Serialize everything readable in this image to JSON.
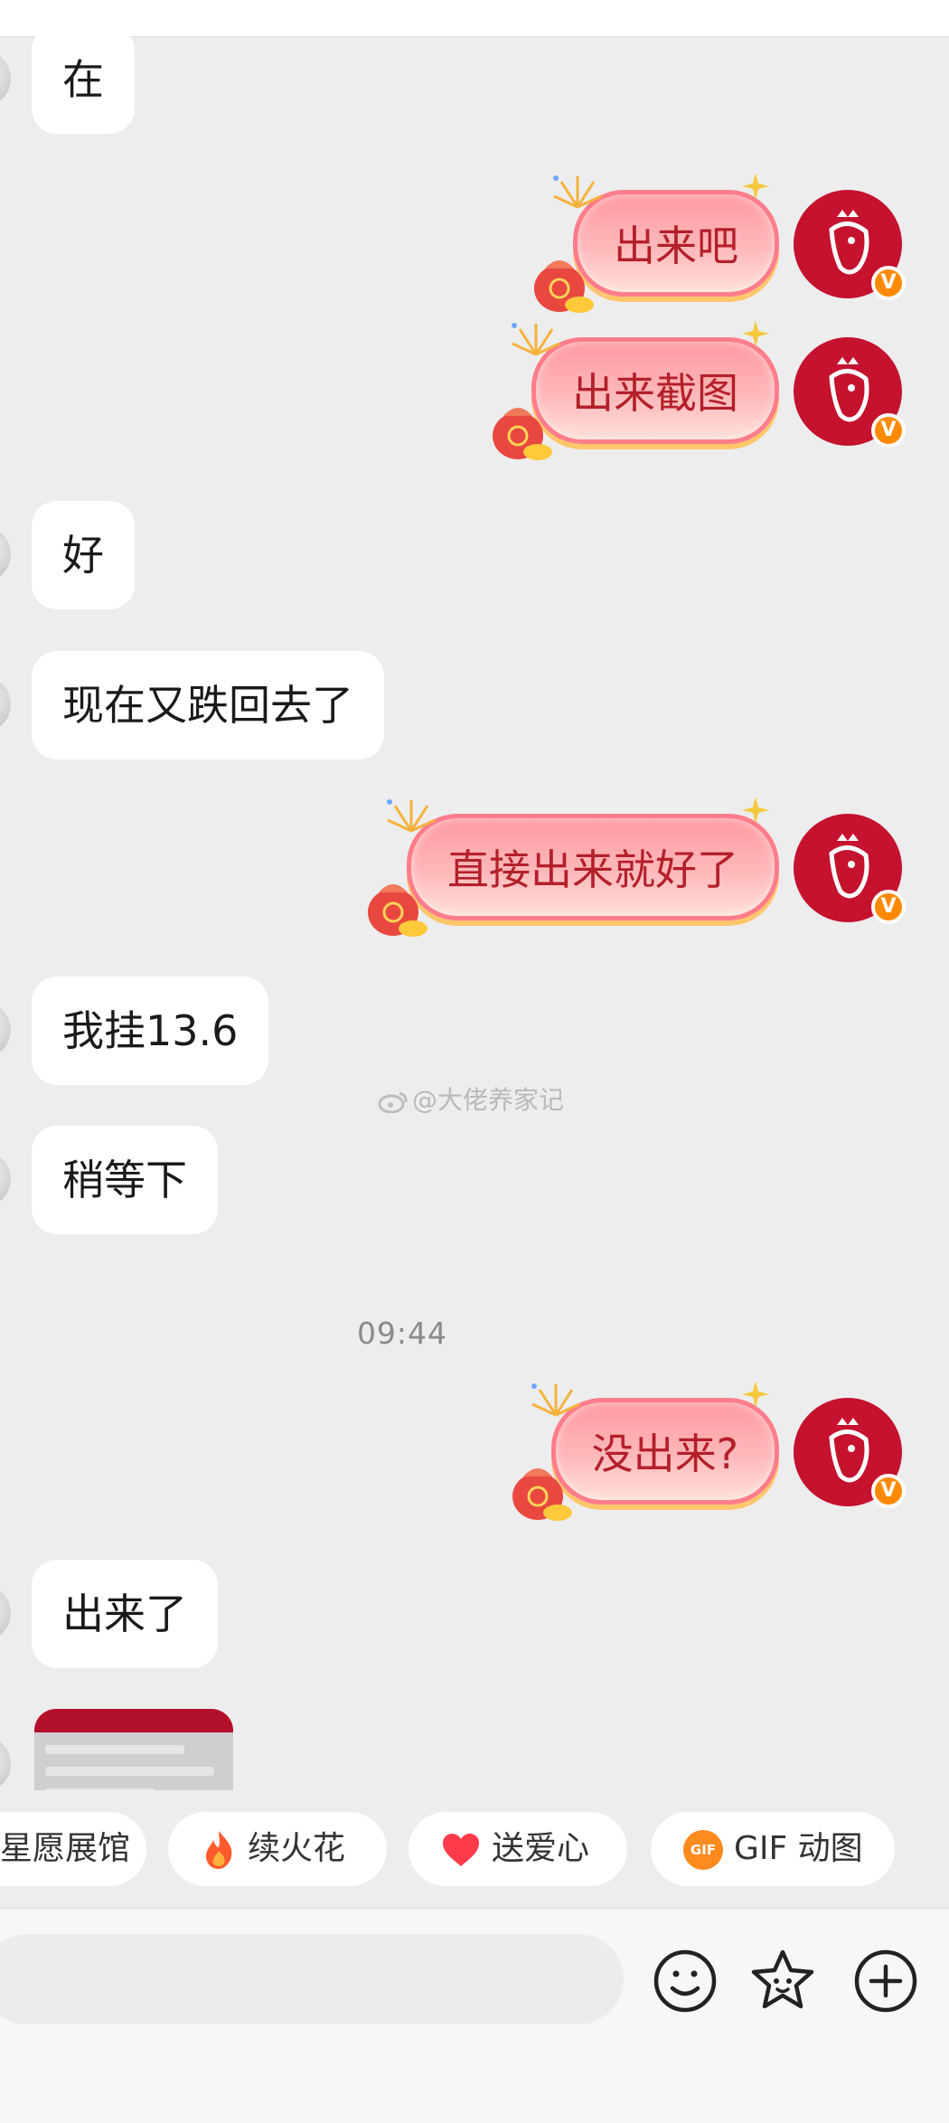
{
  "messages": {
    "m1": {
      "text": "在"
    },
    "m2": {
      "text": "出来吧"
    },
    "m3": {
      "text": "出来截图"
    },
    "m4": {
      "text": "好"
    },
    "m5": {
      "text": "现在又跌回去了"
    },
    "m6": {
      "text": "直接出来就好了"
    },
    "m7": {
      "text": "我挂13.6"
    },
    "m8": {
      "text": "稍等下"
    },
    "m9": {
      "text": "没出来?"
    },
    "m10": {
      "text": "出来了"
    }
  },
  "timestamp": "09:44",
  "watermark": "@大佬养家记",
  "verified_badge": "V",
  "quick_actions": [
    {
      "label": "星愿展馆"
    },
    {
      "label": "续火花",
      "icon": "fire-icon"
    },
    {
      "label": "送爱心",
      "icon": "heart-icon"
    },
    {
      "label": "GIF 动图",
      "icon": "gif-icon",
      "icon_text": "GIF"
    }
  ],
  "toolbar": {
    "icons": [
      "emoji-icon",
      "sticker-icon",
      "plus-icon"
    ]
  },
  "colors": {
    "bubble_text": "#b3202a",
    "avatar": "#c4122f",
    "badge": "#ff8a00"
  }
}
